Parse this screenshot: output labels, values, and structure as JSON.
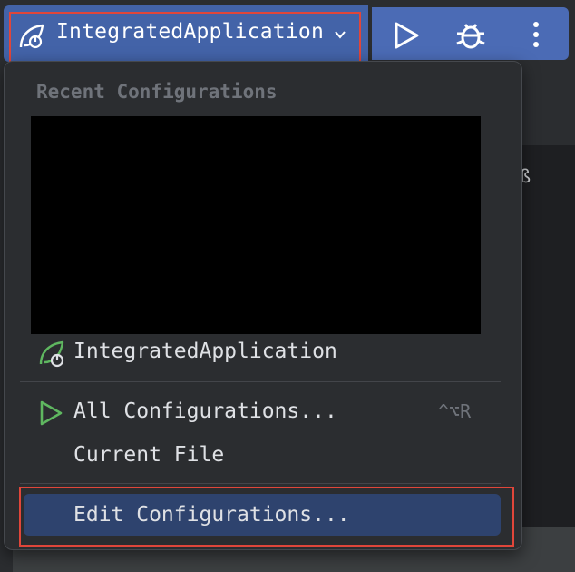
{
  "toolbar": {
    "run_config_label": "IntegratedApplication",
    "run_icon": "run-icon",
    "debug_icon": "debug-icon",
    "more_icon": "more-vertical-icon"
  },
  "popup": {
    "section_title": "Recent Configurations",
    "recent_item": "IntegratedApplication",
    "all_configurations": "All Configurations...",
    "all_configurations_shortcut": "^⌥R",
    "current_file": "Current File",
    "edit_configurations": "Edit Configurations..."
  },
  "colors": {
    "accent": "#3574f0",
    "highlight_border": "#e0463a",
    "selected_row": "#2e436e",
    "spring_icon": "#5fb760"
  }
}
